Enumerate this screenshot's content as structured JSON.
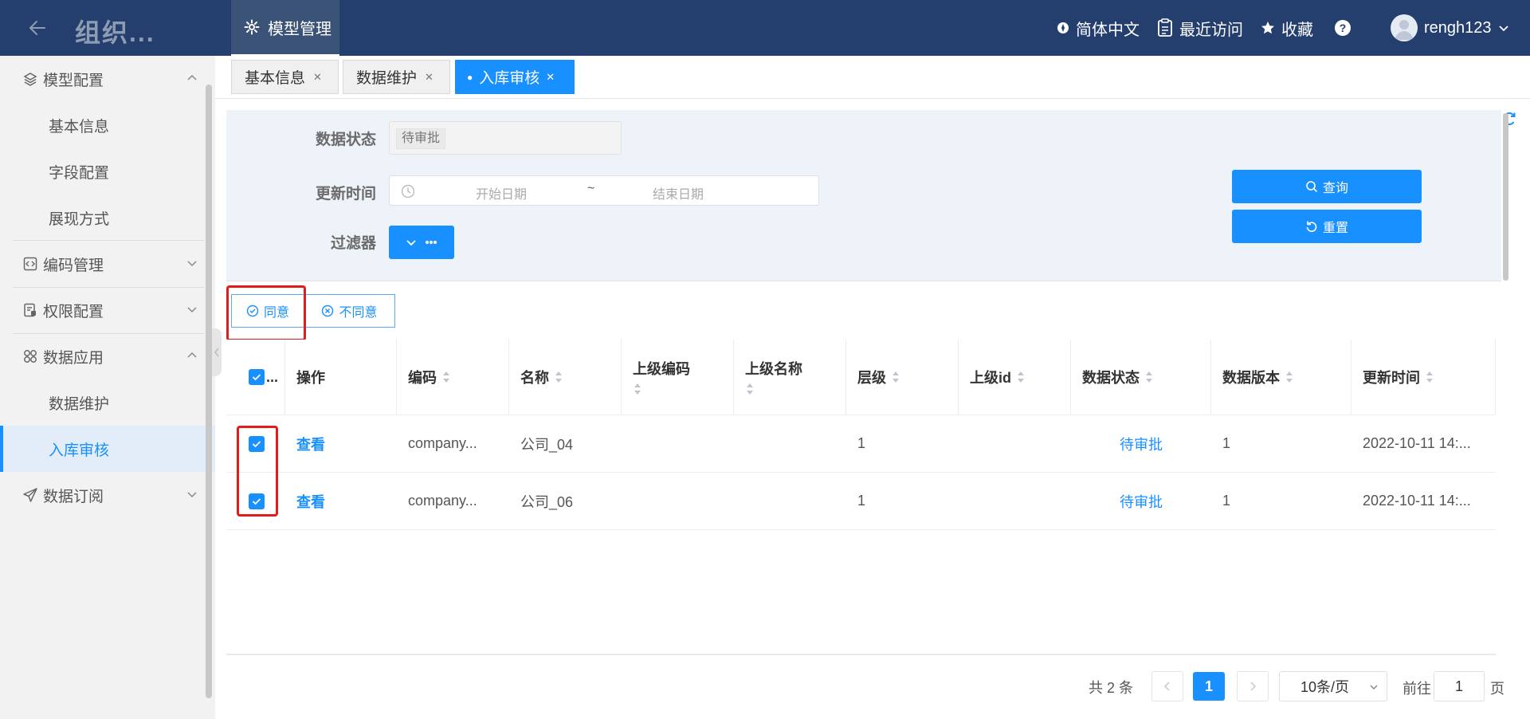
{
  "header": {
    "app_title": "组织...",
    "module_tab": "模型管理",
    "language": "简体中文",
    "recent": "最近访问",
    "favorites": "收藏",
    "help_icon": "question-circle-icon",
    "username": "rengh123"
  },
  "sidebar": {
    "groups": [
      {
        "label": "模型配置",
        "icon": "layers-icon",
        "expanded": true,
        "children": [
          "基本信息",
          "字段配置",
          "展现方式"
        ]
      },
      {
        "label": "编码管理",
        "icon": "code-icon",
        "expanded": false
      },
      {
        "label": "权限配置",
        "icon": "permission-icon",
        "expanded": false
      },
      {
        "label": "数据应用",
        "icon": "apps-icon",
        "expanded": true,
        "children": [
          "数据维护",
          "入库审核"
        ]
      },
      {
        "label": "数据订阅",
        "icon": "send-icon",
        "expanded": false
      }
    ],
    "active_item": "入库审核"
  },
  "page_tabs": [
    {
      "label": "基本信息",
      "active": false
    },
    {
      "label": "数据维护",
      "active": false
    },
    {
      "label": "入库审核",
      "active": true
    }
  ],
  "filters": {
    "status_label": "数据状态",
    "status_value": "待审批",
    "time_label": "更新时间",
    "date_start_placeholder": "开始日期",
    "date_separator": "~",
    "date_end_placeholder": "结束日期",
    "filter_label": "过滤器",
    "query_button": "查询",
    "reset_button": "重置"
  },
  "actions": {
    "approve": "同意",
    "reject": "不同意"
  },
  "table": {
    "select_header": "...",
    "columns": [
      "操作",
      "编码",
      "名称",
      "上级编码",
      "上级名称",
      "层级",
      "上级id",
      "数据状态",
      "数据版本",
      "更新时间"
    ],
    "rows": [
      {
        "checked": true,
        "action": "查看",
        "code": "company...",
        "name": "公司_04",
        "parent_code": "",
        "parent_name": "",
        "level": "1",
        "parent_id": "",
        "status": "待审批",
        "version": "1",
        "updated": "2022-10-11 14:..."
      },
      {
        "checked": true,
        "action": "查看",
        "code": "company...",
        "name": "公司_06",
        "parent_code": "",
        "parent_name": "",
        "level": "1",
        "parent_id": "",
        "status": "待审批",
        "version": "1",
        "updated": "2022-10-11 14:..."
      }
    ]
  },
  "pagination": {
    "total": "共 2 条",
    "current_page": "1",
    "page_size": "10条/页",
    "goto_prefix": "前往",
    "goto_value": "1",
    "goto_suffix": "页"
  },
  "colors": {
    "header_bg": "#243f6e",
    "primary": "#1890ff",
    "highlight_box": "#e01c1c"
  }
}
